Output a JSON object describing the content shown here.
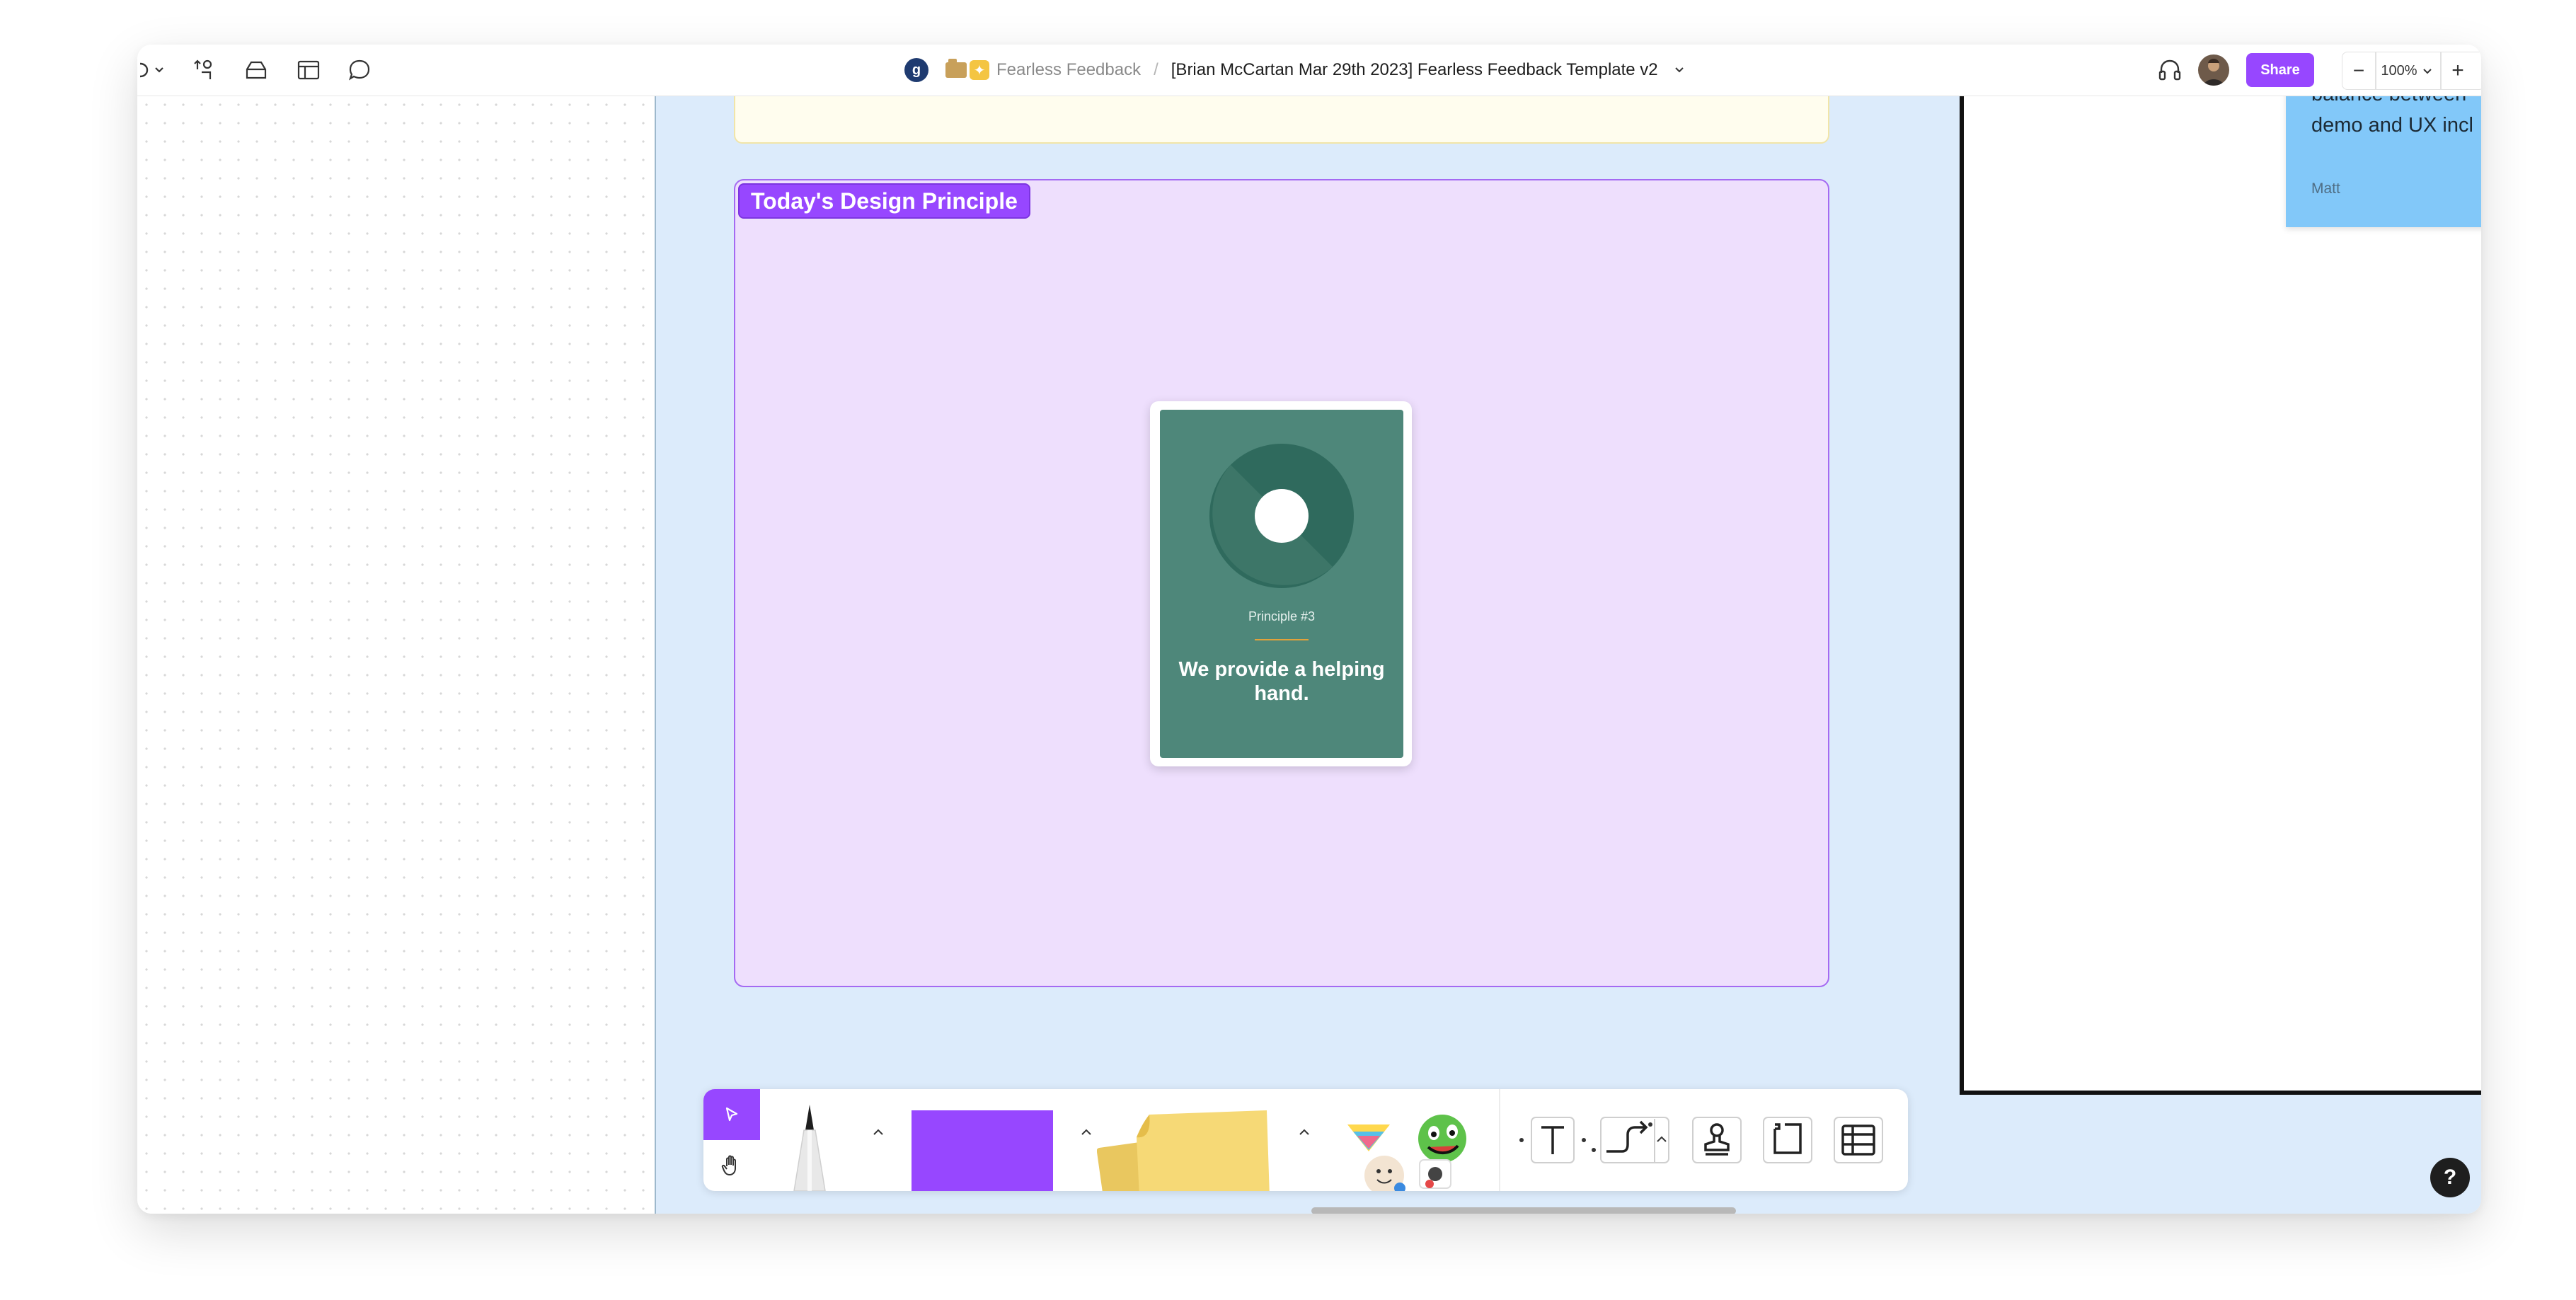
{
  "topbar": {
    "breadcrumb": {
      "workspace_initial": "g",
      "project": "Fearless Feedback",
      "separator": "/",
      "file": "[Brian McCartan Mar 29th 2023] Fearless Feedback Template v2"
    },
    "share_label": "Share",
    "zoom": {
      "minus": "−",
      "value": "100%",
      "plus": "+"
    },
    "icons": [
      "menu-chevron-icon",
      "swap-icon",
      "stack-icon",
      "layout-icon",
      "comment-icon",
      "headphones-icon",
      "avatar"
    ]
  },
  "canvas": {
    "frame_label": "Today's Design Principle",
    "card": {
      "number": "Principle #3",
      "text": "We provide a helping hand."
    },
    "sticky": {
      "lines": [
        "balance between",
        "demo and UX incl"
      ],
      "author": "Matt"
    }
  },
  "toolbar": {
    "tools": [
      "move",
      "hand",
      "marker",
      "shape",
      "sticky",
      "stickers",
      "text",
      "connector",
      "stamp",
      "section",
      "table"
    ]
  },
  "help_label": "?",
  "colors": {
    "accent": "#9747ff",
    "canvas_bg": "#dcebfb",
    "section_bg": "#eedffd",
    "card_green": "#4e877a",
    "sticky_blue": "#82c8f9"
  }
}
